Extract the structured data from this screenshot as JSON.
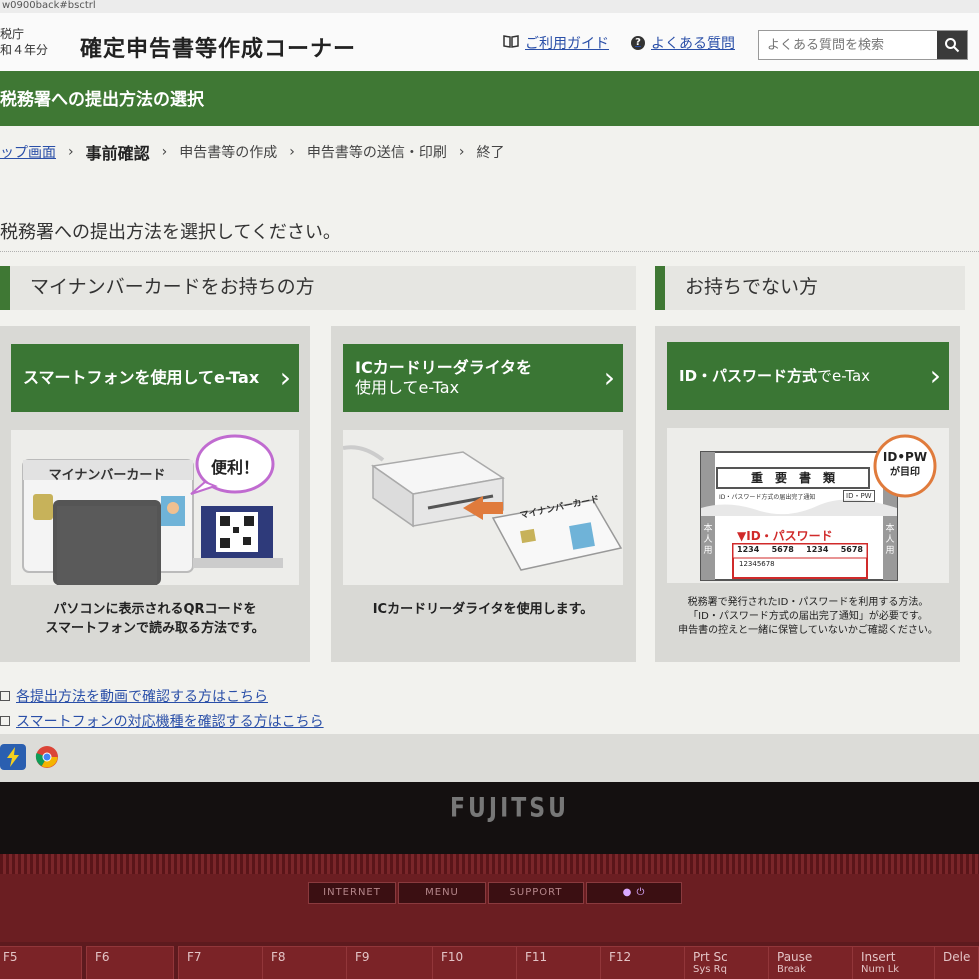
{
  "url_fragment": "w0900back#bsctrl",
  "header": {
    "agency_line1": "税庁",
    "agency_line2": "和４年分",
    "site_title": "確定申告書等作成コーナー",
    "guide_link": "ご利用ガイド",
    "faq_link": "よくある質問",
    "search_placeholder": "よくある質問を検索"
  },
  "page_title": "税務署への提出方法の選択",
  "breadcrumb": {
    "top": "ップ画面",
    "current": "事前確認",
    "step3": "申告書等の作成",
    "step4": "申告書等の送信・印刷",
    "step5": "終了"
  },
  "instruction": "税務署への提出方法を選択してください。",
  "sections": {
    "with_card": "マイナンバーカードをお持ちの方",
    "without_card": "お持ちでない方"
  },
  "options": {
    "smartphone": {
      "button_label": "スマートフォンを使用してe-Tax",
      "card_label": "マイナンバーカード",
      "bubble": "便利！",
      "desc_line1": "パソコンに表示されるQRコードを",
      "desc_line2": "スマートフォンで読み取る方法です。"
    },
    "ic_reader": {
      "button_line1": "ICカードリーダライタを",
      "button_line2": "使用してe-Tax",
      "card_label": "マイナンバーカード",
      "desc": "ICカードリーダライタを使用します。"
    },
    "idpw": {
      "button_bold": "ID・パスワード方式",
      "button_rest": "でe-Tax",
      "doc_title": "重　要　書　類",
      "doc_sub": "ID・パスワード方式の届出完了通知",
      "doc_tag": "ID・PW",
      "doc_idpw_label": "▼ID・パスワード",
      "doc_numbers": [
        "1234",
        "5678",
        "1234",
        "5678"
      ],
      "doc_small_number": "12345678",
      "doc_side": "本人用",
      "stamp_line1": "ID•PW",
      "stamp_line2": "が目印",
      "desc_line1": "税務署で発行されたID・パスワードを利用する方法。",
      "desc_line2": "「ID・パスワード方式の届出完了通知」が必要です。",
      "desc_line3": "申告書の控えと一緒に保管していないかご確認ください。"
    }
  },
  "bottom_links": {
    "video": "各提出方法を動画で確認する方はこちら",
    "models": "スマートフォンの対応機種を確認する方はこちら"
  },
  "laptop": {
    "brand": "FUJITSU",
    "hotkeys": [
      "INTERNET",
      "MENU",
      "SUPPORT"
    ],
    "fkeys": [
      "F5",
      "F6",
      "F7",
      "F8",
      "F9",
      "F10",
      "F11",
      "F12",
      "Prt Sc",
      "Pause",
      "Insert",
      "Dele"
    ],
    "fkeys_sub": [
      "",
      "",
      "",
      "",
      "",
      "",
      "",
      "",
      "Sys Rq",
      "Break",
      "Num Lk",
      ""
    ]
  },
  "colors": {
    "green": "#3f7834",
    "link": "#2a4fa8",
    "panel": "#d9d9d5"
  }
}
